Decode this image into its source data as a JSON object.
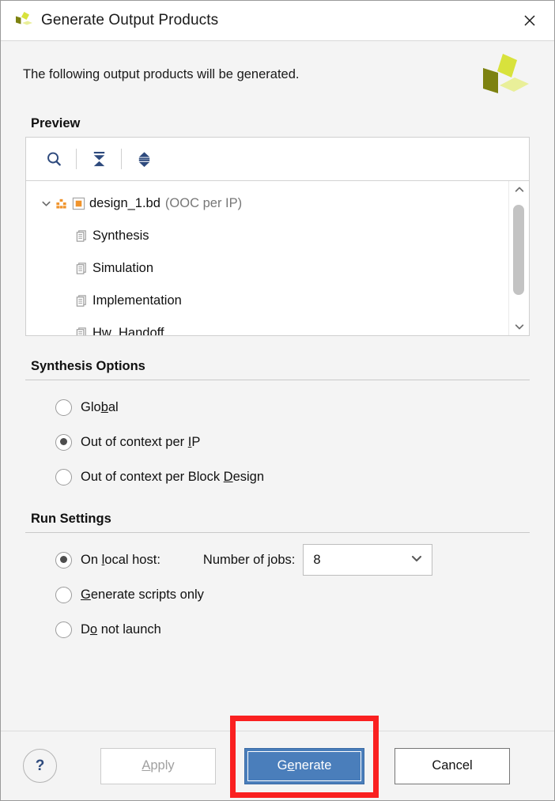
{
  "window": {
    "title": "Generate Output Products",
    "logo_icon": "vivado-pinwheel-logo",
    "close_icon": "close-icon"
  },
  "intro": {
    "text": "The following output products will be generated.",
    "logo_icon": "vivado-pinwheel-logo-large"
  },
  "preview": {
    "title": "Preview",
    "toolbar": [
      {
        "name": "search-icon",
        "label": "Search"
      },
      {
        "name": "collapse-all-icon",
        "label": "Collapse All"
      },
      {
        "name": "expand-all-icon",
        "label": "Expand All"
      }
    ],
    "tree": {
      "root": {
        "label": "design_1.bd",
        "suffix": "(OOC per IP)",
        "expand_icon": "chevron-down-icon",
        "block_icon": "block-design-icon",
        "state_icon": "orange-square-icon"
      },
      "children": [
        {
          "label": "Synthesis",
          "icon": "documents-icon"
        },
        {
          "label": "Simulation",
          "icon": "documents-icon"
        },
        {
          "label": "Implementation",
          "icon": "documents-icon"
        },
        {
          "label": "Hw_Handoff",
          "icon": "documents-icon"
        }
      ]
    },
    "scrollbar": {
      "up_icon": "chevron-up-icon",
      "down_icon": "chevron-down-icon"
    }
  },
  "synthesis_options": {
    "title": "Synthesis Options",
    "options": [
      {
        "label": "Global",
        "mnemonic": "b",
        "checked": false
      },
      {
        "label": "Out of context per IP",
        "mnemonic": "I",
        "checked": true
      },
      {
        "label": "Out of context per Block Design",
        "mnemonic": "D",
        "checked": false
      }
    ]
  },
  "run_settings": {
    "title": "Run Settings",
    "options": [
      {
        "label": "On local host:",
        "mnemonic": "l",
        "checked": true
      },
      {
        "label": "Generate scripts only",
        "mnemonic": "G",
        "checked": false
      },
      {
        "label": "Do not launch",
        "mnemonic": "o",
        "checked": false
      }
    ],
    "jobs_label": "Number of jobs:",
    "jobs_value": "8",
    "jobs_dropdown_icon": "chevron-down-icon"
  },
  "footer": {
    "help_label": "?",
    "apply_label": "Apply",
    "apply_mnemonic": "A",
    "generate_label": "Generate",
    "generate_mnemonic": "e",
    "cancel_label": "Cancel"
  },
  "colors": {
    "accent_blue": "#4a7ebb",
    "highlight_red": "#fa2020",
    "logo_bright": "#d8e23c",
    "logo_dark": "#7d8210",
    "logo_pale": "#e9ef99",
    "tree_orange": "#f0932b",
    "toolbar_icon": "#2e4a7d"
  }
}
